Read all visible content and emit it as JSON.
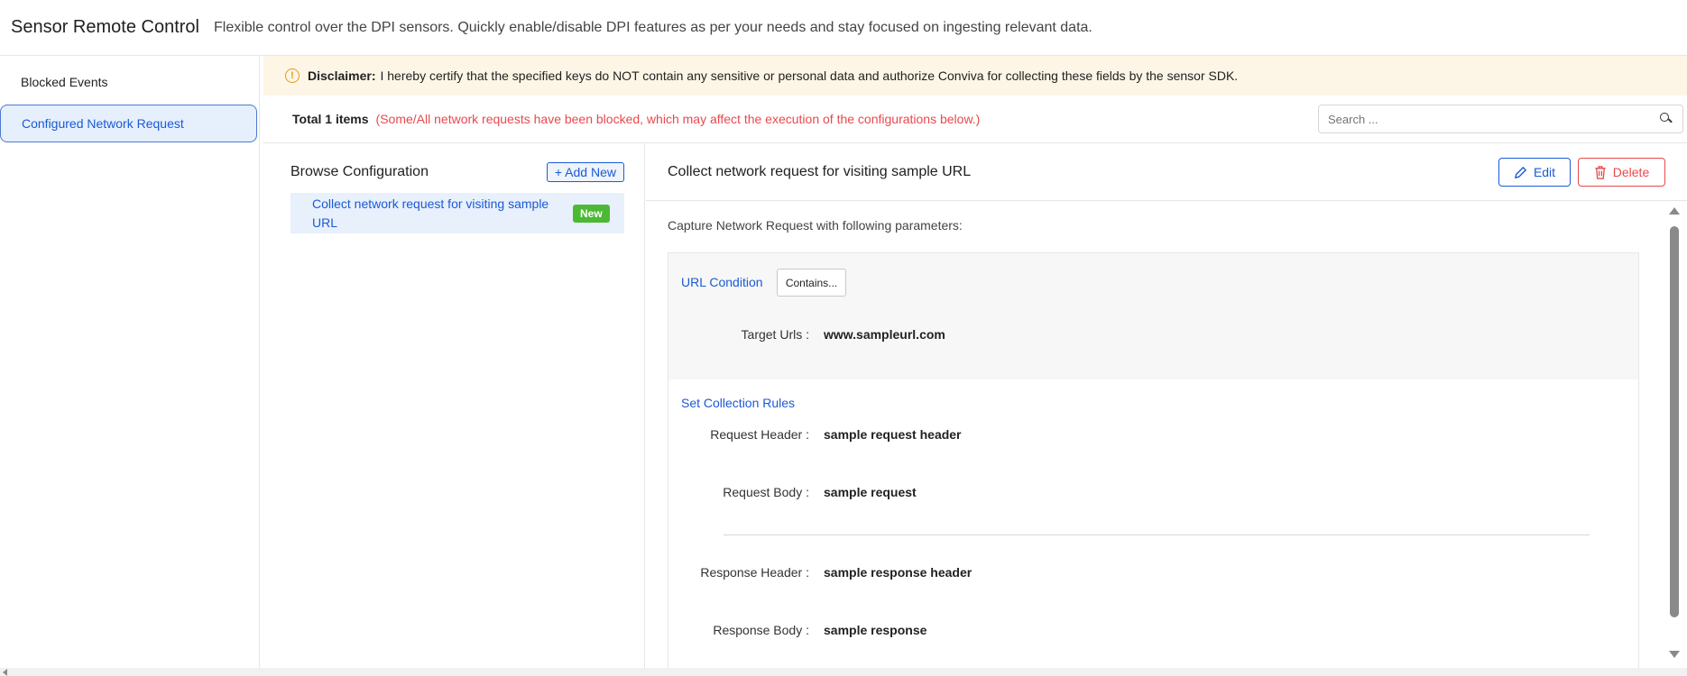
{
  "header": {
    "title": "Sensor Remote Control",
    "description": "Flexible control over the DPI sensors. Quickly enable/disable DPI features as per your needs and stay focused on ingesting relevant data."
  },
  "sidebar": {
    "items": [
      {
        "label": "Blocked Events",
        "active": false
      },
      {
        "label": "Configured Network Request",
        "active": true
      }
    ]
  },
  "disclaimer": {
    "icon": "info-circle-icon",
    "label": "Disclaimer:",
    "text": "I hereby certify that the specified keys do NOT contain any sensitive or personal data and authorize Conviva for collecting these fields by the sensor SDK."
  },
  "toolbar": {
    "total": "Total 1 items",
    "warning": "(Some/All network requests have been blocked, which may affect the execution of the configurations below.)",
    "search_placeholder": "Search ..."
  },
  "browse": {
    "title": "Browse Configuration",
    "add_label": "+ Add New",
    "items": [
      {
        "label": "Collect network request for visiting sample URL",
        "badge": "New"
      }
    ]
  },
  "detail": {
    "title": "Collect network request for visiting sample URL",
    "edit_label": "Edit",
    "delete_label": "Delete",
    "capture_text": "Capture Network Request with following parameters:",
    "url_condition_label": "URL Condition",
    "url_condition_value": "Contains...",
    "target_urls_label": "Target Urls :",
    "target_urls_value": "www.sampleurl.com",
    "collection_rules_label": "Set Collection Rules",
    "request_header_label": "Request Header :",
    "request_header_value": "sample request header",
    "request_body_label": "Request Body :",
    "request_body_value": "sample request",
    "response_header_label": "Response Header :",
    "response_header_value": "sample response header",
    "response_body_label": "Response Body :",
    "response_body_value": "sample response"
  },
  "colors": {
    "accent": "#1a5ad6",
    "danger": "#e8494d",
    "badge_green": "#4cb934",
    "disclaimer_bg": "#fdf5e6"
  }
}
